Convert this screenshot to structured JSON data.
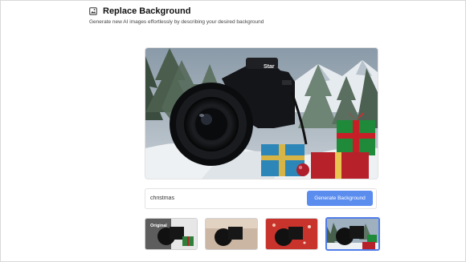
{
  "app": {
    "title": "Replace Background",
    "subtitle": "Generate new AI images effortlessly by describing your desired background",
    "title_icon": "image-sparkle-icon"
  },
  "preview": {
    "camera_brand": "Star",
    "scene": "christmas"
  },
  "prompt": {
    "value": "christmas",
    "button_label": "Generate Background"
  },
  "thumbnails": [
    {
      "label": "Original",
      "selected": false
    },
    {
      "label": "",
      "selected": false
    },
    {
      "label": "",
      "selected": false
    },
    {
      "label": "",
      "selected": true
    }
  ],
  "colors": {
    "accent": "#5b8def",
    "selected_border": "#4f7dea"
  }
}
